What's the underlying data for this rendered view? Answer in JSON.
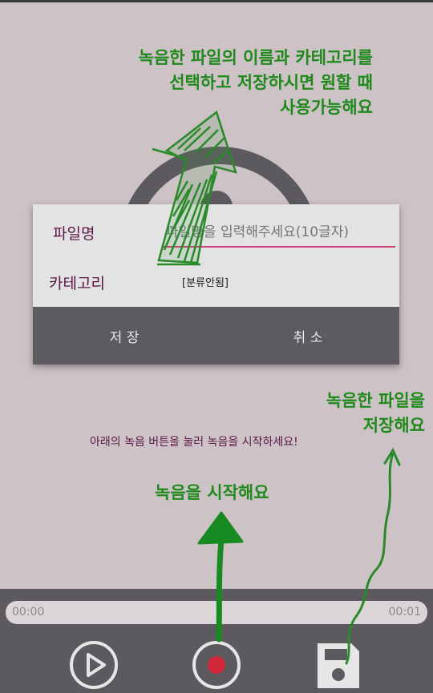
{
  "tutorial": {
    "hint_save_line1": "녹음한 파일의 이름과 카테고리를",
    "hint_save_line2": "선택하고 저장하시면 원할 때",
    "hint_save_line3": "사용가능해요",
    "hint_file_line1": "녹음한 파일을",
    "hint_file_line2": "저장해요",
    "hint_record": "녹음을 시작해요"
  },
  "dialog": {
    "filename_label": "파일명",
    "filename_value": "",
    "filename_placeholder": "파일명을 입력해주세요(10글자)",
    "category_label": "카테고리",
    "category_value": "[분류안됨]",
    "save_button": "저 장",
    "cancel_button": "취 소"
  },
  "main": {
    "instruction": "아래의 녹음 버튼을 눌러 녹음을 시작하세요!"
  },
  "player": {
    "time_current": "00:00",
    "time_total": "00:01",
    "progress_fraction": 0
  },
  "icons": {
    "play": "play-icon",
    "record": "record-icon",
    "save": "save-icon"
  },
  "colors": {
    "background": "#cdc2c6",
    "panel": "#5c5a5e",
    "hint_green": "#1f8a1b",
    "accent_pink": "#cc3f7a",
    "label_purple": "#5a1846",
    "record_red": "#d3283a"
  }
}
